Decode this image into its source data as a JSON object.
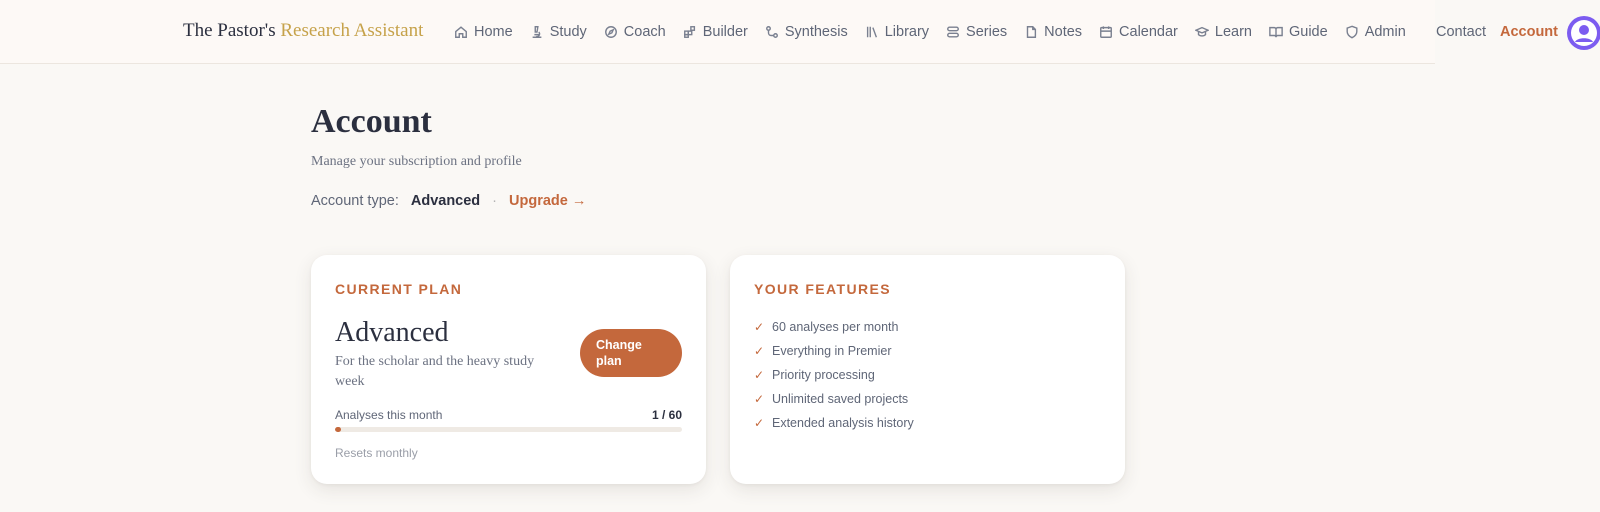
{
  "brand": {
    "name_part1": "The Pastor's",
    "name_part2": "Research Assistant"
  },
  "nav": [
    {
      "label": "Home",
      "icon": "home-icon"
    },
    {
      "label": "Study",
      "icon": "microscope-icon"
    },
    {
      "label": "Coach",
      "icon": "compass-icon"
    },
    {
      "label": "Builder",
      "icon": "blocks-icon"
    },
    {
      "label": "Synthesis",
      "icon": "workflow-icon"
    },
    {
      "label": "Library",
      "icon": "library-icon"
    },
    {
      "label": "Series",
      "icon": "series-icon"
    },
    {
      "label": "Notes",
      "icon": "file-icon"
    },
    {
      "label": "Calendar",
      "icon": "calendar-icon"
    },
    {
      "label": "Learn",
      "icon": "graduation-cap-icon"
    },
    {
      "label": "Guide",
      "icon": "book-open-icon"
    },
    {
      "label": "Admin",
      "icon": "shield-icon"
    }
  ],
  "header": {
    "contact": "Contact",
    "account": "Account"
  },
  "page": {
    "title": "Account",
    "subtitle": "Manage your subscription and profile",
    "account_type_label": "Account type:",
    "account_type_value": "Advanced",
    "separator": "·",
    "upgrade": "Upgrade →"
  },
  "plan_card": {
    "heading": "CURRENT PLAN",
    "name": "Advanced",
    "description": "For the scholar and the heavy study week",
    "change_button": "Change plan",
    "usage_label": "Analyses this month",
    "usage_count": "1 / 60",
    "usage_fraction": 0.0167,
    "resets": "Resets monthly"
  },
  "features_card": {
    "heading": "YOUR FEATURES",
    "check_glyph": "✓",
    "items": [
      "60 analyses per month",
      "Everything in Premier",
      "Priority processing",
      "Unlimited saved projects",
      "Extended analysis history"
    ]
  },
  "colors": {
    "accent": "#c4683c",
    "brand_gold": "#c6a24a",
    "avatar": "#7c5cf0"
  }
}
